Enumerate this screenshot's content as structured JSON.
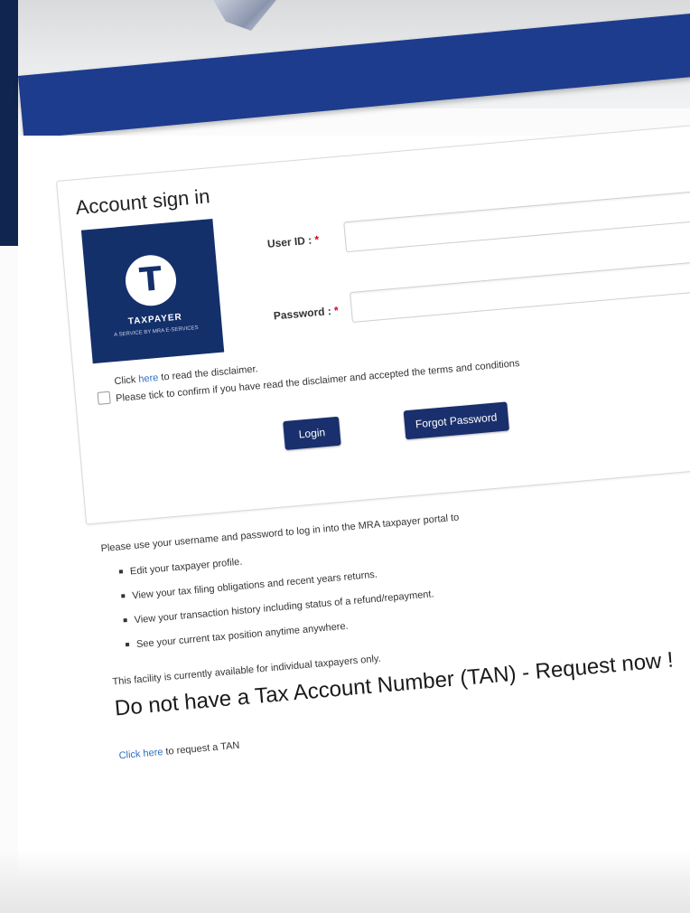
{
  "signin": {
    "title": "Account sign in",
    "logo": {
      "emblem_letter": "T",
      "wordmark": "TAXPAYER",
      "tagline": "A SERVICE BY MRA E-SERVICES"
    },
    "userid": {
      "label": "User ID :",
      "required_mark": "*",
      "value": ""
    },
    "password": {
      "label": "Password :",
      "required_mark": "*",
      "value": ""
    },
    "disclaimer": {
      "prefix": "Click ",
      "link": "here",
      "suffix": " to read the disclaimer."
    },
    "confirm_text": "Please tick to confirm if you have read the disclaimer and accepted the terms and conditions",
    "login_label": "Login",
    "forgot_label": "Forgot Password"
  },
  "info": {
    "intro": "Please use your username and password to log in into the MRA taxpayer portal to",
    "features": [
      "Edit your taxpayer profile.",
      "View your tax filing obligations and recent years returns.",
      "View your transaction history including status of a refund/repayment.",
      "See your current tax position anytime anywhere."
    ],
    "facility_note": "This facility is currently available for individual taxpayers only.",
    "tan_heading": "Do not have a Tax Account Number (TAN) - Request now !",
    "tan_link": "Click here",
    "tan_suffix": " to request a TAN"
  },
  "colors": {
    "nav_blue": "#1e3c8e",
    "button_navy": "#1a2f6d",
    "logo_navy": "#14306b",
    "link_blue": "#2a6fc4",
    "required_red": "#d0021b"
  }
}
